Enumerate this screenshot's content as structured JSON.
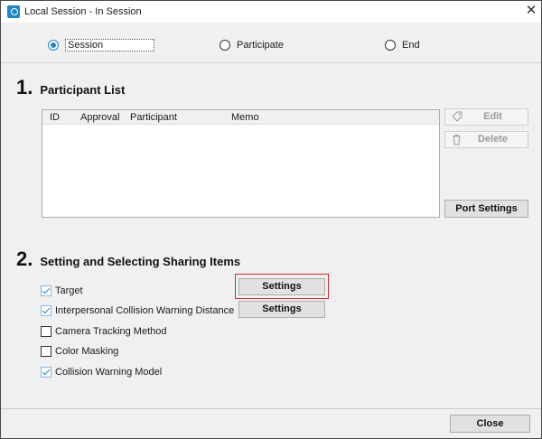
{
  "window": {
    "title": "Local Session - In Session",
    "close_glyph": "✕"
  },
  "modes": {
    "selected": "Session",
    "items": [
      {
        "label": "Session",
        "checked": true
      },
      {
        "label": "Participate",
        "checked": false
      },
      {
        "label": "End",
        "checked": false
      }
    ]
  },
  "participant_section": {
    "number": "1.",
    "title": "Participant List",
    "columns": [
      "ID",
      "Approval",
      "Participant",
      "Memo"
    ],
    "rows": [],
    "buttons": {
      "edit": {
        "label": "Edit",
        "icon": "tag-icon",
        "enabled": false
      },
      "delete": {
        "label": "Delete",
        "icon": "trash-icon",
        "enabled": false
      },
      "port_settings": {
        "label": "Port Settings",
        "enabled": true
      }
    }
  },
  "sharing_section": {
    "number": "2.",
    "title": "Setting and Selecting Sharing Items",
    "items": [
      {
        "label": "Target",
        "checked": true,
        "settings_label": "Settings"
      },
      {
        "label": "Interpersonal Collision Warning Distance",
        "checked": true,
        "settings_label": "Settings"
      },
      {
        "label": "Camera Tracking Method",
        "checked": false
      },
      {
        "label": "Color Masking",
        "checked": false
      },
      {
        "label": "Collision Warning Model",
        "checked": true
      }
    ]
  },
  "footer": {
    "close_label": "Close"
  },
  "colors": {
    "accent": "#1f86c9",
    "highlight_frame": "#d42a2a",
    "panel_bg": "#f0f0f0",
    "button_bg": "#e1e1e1"
  }
}
